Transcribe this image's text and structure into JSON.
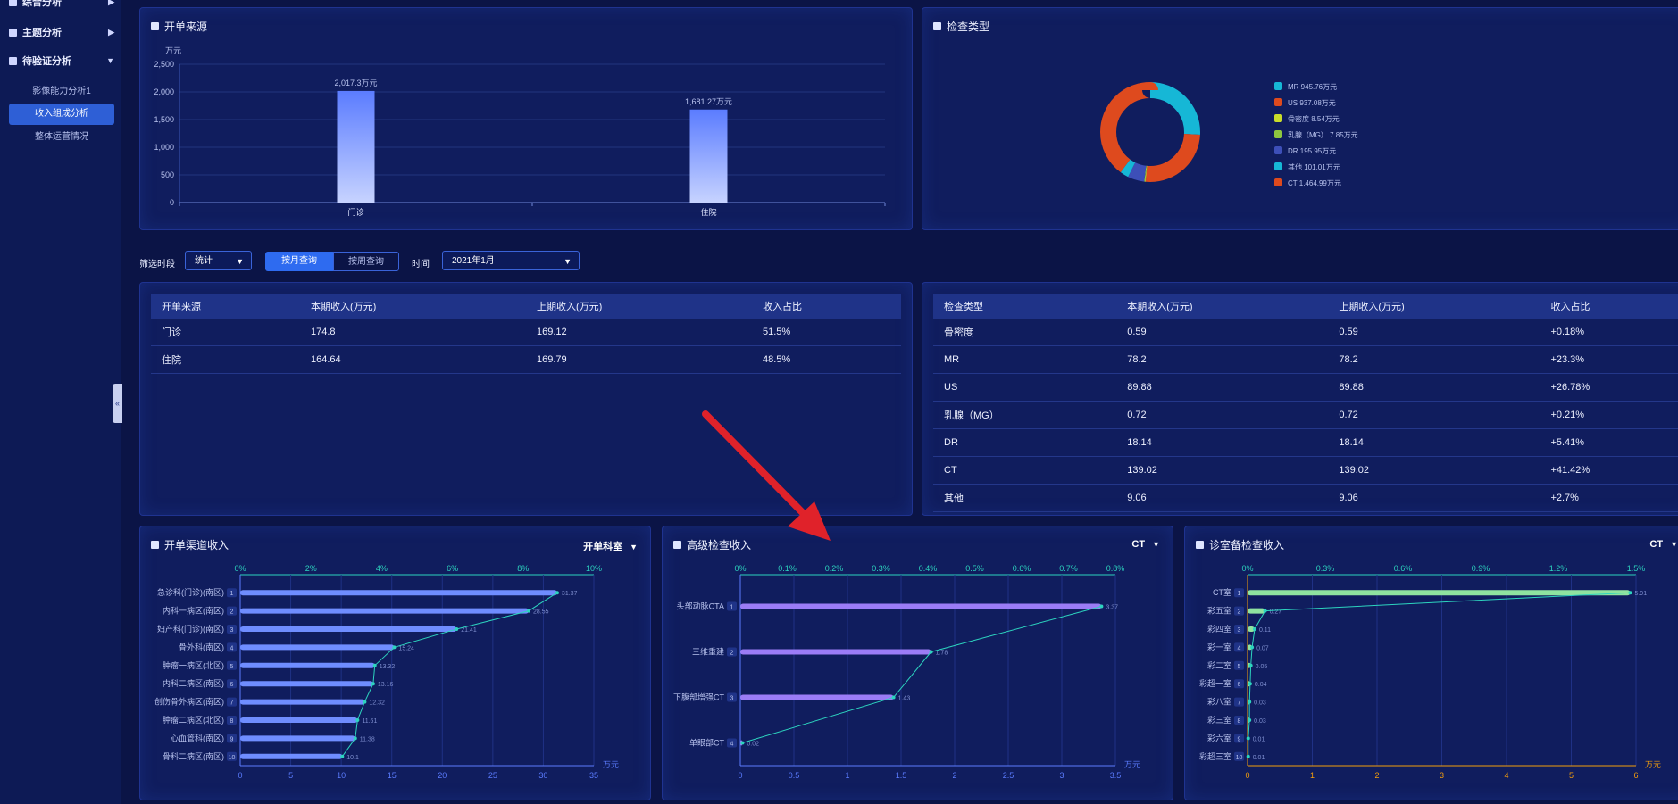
{
  "sidebar": {
    "groups": [
      {
        "label": "综合分析"
      },
      {
        "label": "主题分析"
      },
      {
        "label": "待验证分析"
      }
    ],
    "items": [
      {
        "label": "影像能力分析1"
      },
      {
        "label": "收入组成分析"
      },
      {
        "label": "整体运营情况"
      }
    ],
    "collapse_icon": "«"
  },
  "panels": {
    "source_chart": {
      "title": "开单来源"
    },
    "exam_type_chart": {
      "title": "检查类型"
    },
    "channel": {
      "title": "开单渠道收入",
      "dropdown": "开单科室"
    },
    "advanced": {
      "title": "高级检查收入",
      "dropdown": "CT"
    },
    "room": {
      "title": "诊室备检查收入",
      "dropdown": "CT"
    }
  },
  "filters": {
    "period_label": "筛选时段",
    "period_value": "统计",
    "by_month": "按月查询",
    "by_week": "按周查询",
    "time_label": "时间",
    "time_value": "2021年1月"
  },
  "source_table": {
    "headers": [
      "开单来源",
      "本期收入(万元)",
      "上期收入(万元)",
      "收入占比"
    ],
    "rows": [
      [
        "门诊",
        "174.8",
        "169.12",
        "51.5%"
      ],
      [
        "住院",
        "164.64",
        "169.79",
        "48.5%"
      ]
    ]
  },
  "exam_table": {
    "headers": [
      "检查类型",
      "本期收入(万元)",
      "上期收入(万元)",
      "收入占比"
    ],
    "rows": [
      [
        "骨密度",
        "0.59",
        "0.59",
        "+0.18%"
      ],
      [
        "MR",
        "78.2",
        "78.2",
        "+23.3%"
      ],
      [
        "US",
        "89.88",
        "89.88",
        "+26.78%"
      ],
      [
        "乳腺（MG）",
        "0.72",
        "0.72",
        "+0.21%"
      ],
      [
        "DR",
        "18.14",
        "18.14",
        "+5.41%"
      ],
      [
        "CT",
        "139.02",
        "139.02",
        "+41.42%"
      ],
      [
        "其他",
        "9.06",
        "9.06",
        "+2.7%"
      ]
    ]
  },
  "chart_data": [
    {
      "id": "source",
      "type": "bar",
      "unit_label": "万元",
      "categories": [
        "门诊",
        "住院"
      ],
      "values": [
        2017.3,
        1681.27
      ],
      "value_labels": [
        "2,017.3万元",
        "1,681.27万元"
      ],
      "yticks": [
        "0",
        "500",
        "1,000",
        "1,500",
        "2,000",
        "2,500"
      ],
      "ylim": [
        0,
        2500
      ],
      "grid": true
    },
    {
      "id": "exam_type",
      "type": "pie",
      "legend_position": "right",
      "slices": [
        {
          "label": "MR",
          "value": 945.76,
          "display": "MR  945.76万元",
          "color": "#16b7d6"
        },
        {
          "label": "US",
          "value": 937.08,
          "display": "US  937.08万元",
          "color": "#de4a1e"
        },
        {
          "label": "骨密度",
          "value": 8.54,
          "display": "骨密度  8.54万元",
          "color": "#c9dc2a"
        },
        {
          "label": "乳腺（MG）",
          "value": 7.85,
          "display": "乳腺（MG）  7.85万元",
          "color": "#8dc63f"
        },
        {
          "label": "DR",
          "value": 195.95,
          "display": "DR  195.95万元",
          "color": "#3d4fb8"
        },
        {
          "label": "其他",
          "value": 101.01,
          "display": "其他  101.01万元",
          "color": "#16b7d6"
        },
        {
          "label": "CT",
          "value": 1464.99,
          "display": "CT  1,464.99万元",
          "color": "#de4a1e"
        }
      ]
    },
    {
      "id": "channel",
      "type": "bar",
      "orientation": "horizontal",
      "categories": [
        "急诊科(门诊)(南区)",
        "内科一病区(南区)",
        "妇产科(门诊)(南区)",
        "骨外科(南区)",
        "肿瘤一病区(北区)",
        "内科二病区(南区)",
        "创伤骨外病区(南区)",
        "肿瘤二病区(北区)",
        "心血管科(南区)",
        "骨科二病区(南区)"
      ],
      "values": [
        31.37,
        28.55,
        21.41,
        15.24,
        13.32,
        13.16,
        12.32,
        11.61,
        11.38,
        10.1
      ],
      "value_labels": [
        "31.37",
        "28.55",
        "21.41",
        "15.24",
        "13.32",
        "13.16",
        "12.32",
        "11.61",
        "11.38",
        "10.1"
      ],
      "x_top_ticks": [
        "0%",
        "2%",
        "4%",
        "6%",
        "8%",
        "10%"
      ],
      "x_bottom_ticks": [
        "0",
        "5",
        "10",
        "15",
        "20",
        "25",
        "30",
        "35"
      ],
      "xlim": [
        0,
        35
      ],
      "unit_label": "万元",
      "bar_color": "#6f8dff",
      "line_color": "#2dd4bf"
    },
    {
      "id": "advanced",
      "type": "bar",
      "orientation": "horizontal",
      "categories": [
        "头部动脉CTA",
        "三维重建",
        "下腹部增强CT",
        "单眼部CT"
      ],
      "values": [
        3.37,
        1.78,
        1.43,
        0.02
      ],
      "value_labels": [
        "3.37",
        "1.78",
        "1.43",
        "0.02"
      ],
      "x_top_ticks": [
        "0%",
        "0.1%",
        "0.2%",
        "0.3%",
        "0.4%",
        "0.5%",
        "0.6%",
        "0.7%",
        "0.8%"
      ],
      "x_bottom_ticks": [
        "0",
        "0.5",
        "1",
        "1.5",
        "2",
        "2.5",
        "3",
        "3.5"
      ],
      "xlim": [
        0,
        3.5
      ],
      "unit_label": "万元",
      "bar_color": "#9b7cf6",
      "line_color": "#2dd4bf"
    },
    {
      "id": "room",
      "type": "bar",
      "orientation": "horizontal",
      "categories": [
        "CT室",
        "彩五室",
        "彩四室",
        "彩一室",
        "彩二室",
        "彩超一室",
        "彩八室",
        "彩三室",
        "彩六室",
        "彩超三室"
      ],
      "values": [
        5.91,
        0.27,
        0.11,
        0.07,
        0.05,
        0.04,
        0.03,
        0.03,
        0.01,
        0.01
      ],
      "value_labels": [
        "5.91",
        "0.27",
        "0.11",
        "0.07",
        "0.05",
        "0.04",
        "0.03",
        "0.03",
        "0.01",
        "0.01"
      ],
      "x_top_ticks": [
        "0%",
        "0.3%",
        "0.6%",
        "0.9%",
        "1.2%",
        "1.5%"
      ],
      "x_bottom_ticks": [
        "0",
        "1",
        "2",
        "3",
        "4",
        "5",
        "6"
      ],
      "xlim": [
        0,
        6
      ],
      "unit_label": "万元",
      "bar_color": "#8fe3a0",
      "line_color": "#2dd4bf",
      "axis_color": "#f59e0b"
    }
  ]
}
